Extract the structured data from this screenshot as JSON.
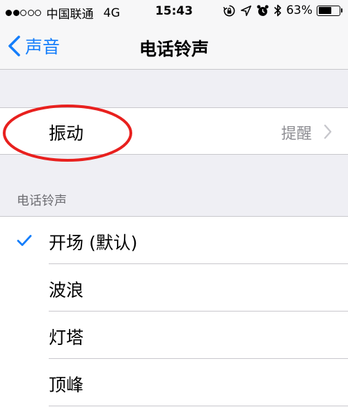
{
  "status_bar": {
    "carrier": "中国联通",
    "network": "4G",
    "time": "15:43",
    "battery_percent": "63%",
    "battery_level": 0.63,
    "signal_bars_filled": 2,
    "signal_bars_total": 5,
    "icons": [
      "rotation-lock-icon",
      "location-arrow-icon",
      "alarm-icon",
      "bluetooth-icon"
    ]
  },
  "nav": {
    "back_label": "声音",
    "title": "电话铃声"
  },
  "vibrate": {
    "label": "振动",
    "value": "提醒"
  },
  "ringtones": {
    "section_header": "电话铃声",
    "items": [
      {
        "label": "开场 (默认)",
        "selected": true
      },
      {
        "label": "波浪",
        "selected": false
      },
      {
        "label": "灯塔",
        "selected": false
      },
      {
        "label": "顶峰",
        "selected": false
      }
    ]
  },
  "colors": {
    "accent": "#157efb",
    "annotation": "#e8201e",
    "background": "#efeff4",
    "secondary_text": "#8e8e93"
  }
}
